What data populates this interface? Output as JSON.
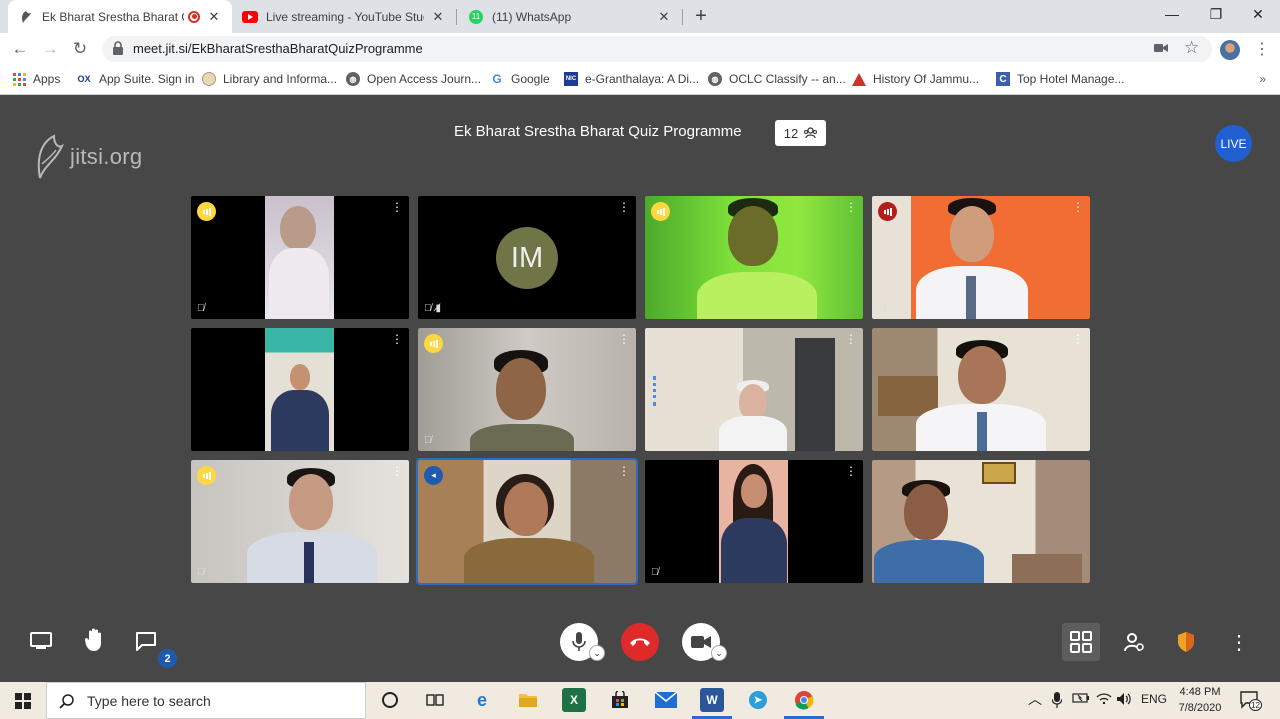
{
  "browser": {
    "tabs": [
      {
        "title": "Ek Bharat Srestha Bharat Qui",
        "active": true,
        "recording": true
      },
      {
        "title": "Live streaming - YouTube Studio",
        "active": false
      },
      {
        "title": "(11) WhatsApp",
        "active": false,
        "badge": "11"
      }
    ],
    "url": "meet.jit.si/EkBharatSresthaBharatQuizProgramme",
    "bookmarks": [
      "Apps",
      "App Suite. Sign in",
      "Library and Informa...",
      "Open Access Journ...",
      "Google",
      "e-Granthalaya: A Di...",
      "OCLC Classify -- an...",
      "History Of Jammu...",
      "Top Hotel Manage..."
    ],
    "bookmark_icons": {
      "ox": "OX",
      "nic": "NIC",
      "c": "C"
    },
    "more_bookmarks": "»"
  },
  "meeting": {
    "logo": "jitsi.org",
    "title": "Ek Bharat Srestha Bharat Quiz Programme",
    "participant_count": "12",
    "live_label": "LIVE",
    "avatar_initials": "IM",
    "chat_unread": "2",
    "colors": {
      "accent": "#1e5ab0",
      "hangup": "#e02a2a",
      "indicator_yellow": "#ffd740",
      "indicator_red": "#b71c1c"
    }
  },
  "taskbar": {
    "search_placeholder": "Type here to search",
    "language": "ENG",
    "time": "4:48 PM",
    "date": "7/8/2020",
    "notification_count": "12",
    "app_icons": {
      "excel": "X",
      "word": "W"
    }
  }
}
